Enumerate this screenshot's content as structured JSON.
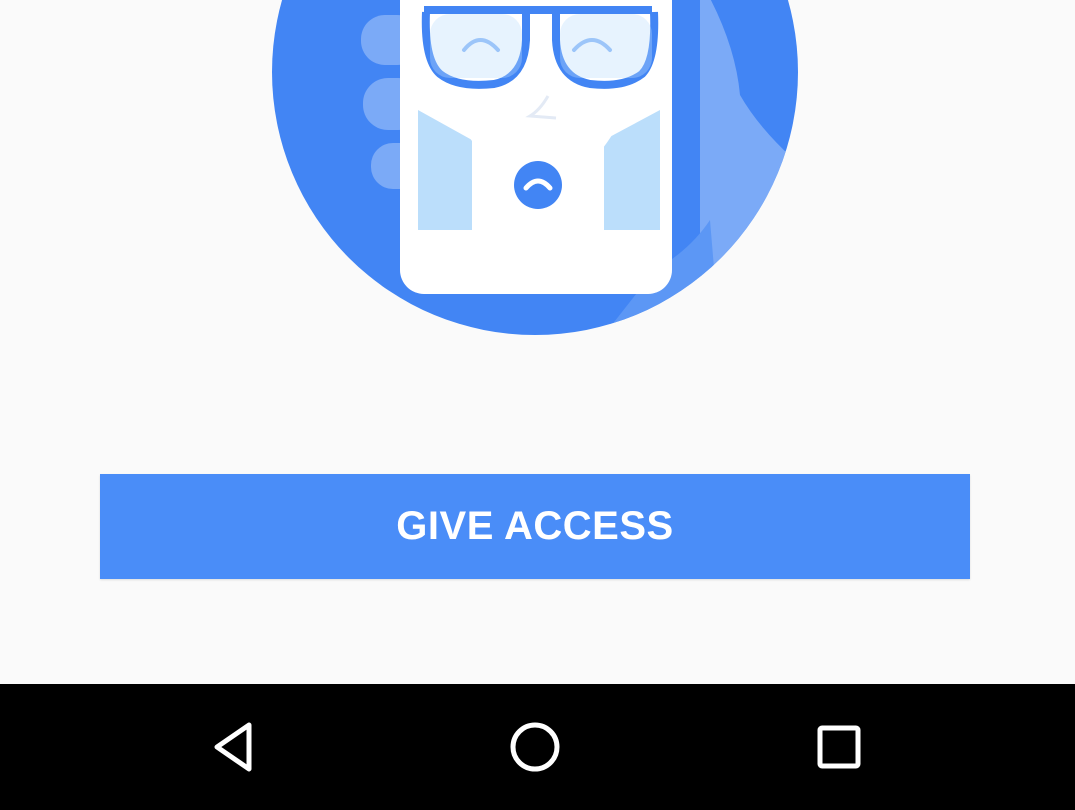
{
  "colors": {
    "accent": "#4a8df8",
    "illustration_blue": "#4285f4",
    "illustration_light": "#bbdefb",
    "background": "#fafafa",
    "navbar": "#000000"
  },
  "illustration": {
    "icon": "video-call-illustration",
    "call_icon": "hang-up-phone-icon"
  },
  "main": {
    "give_access_label": "GIVE ACCESS"
  },
  "navbar": {
    "back_icon": "back-triangle-icon",
    "home_icon": "home-circle-icon",
    "recents_icon": "recents-square-icon"
  }
}
